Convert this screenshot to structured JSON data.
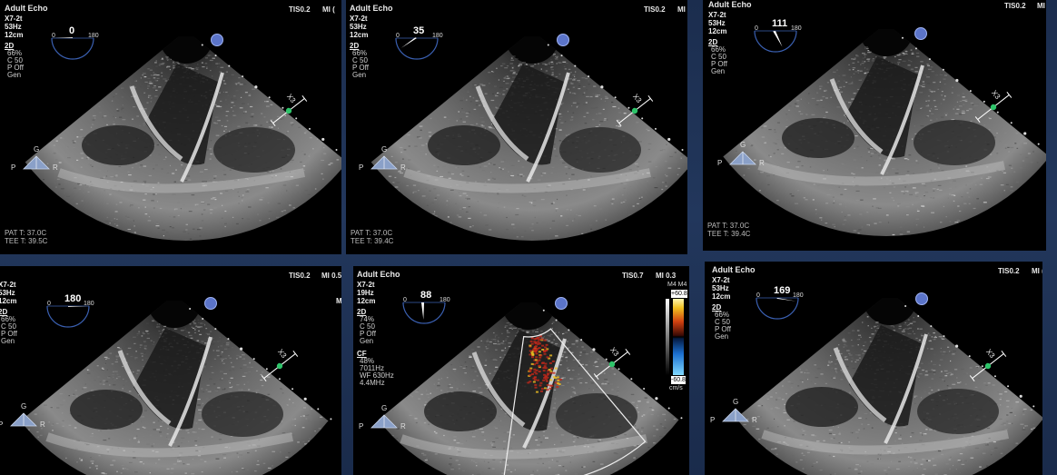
{
  "panels": [
    {
      "header": "Adult Echo",
      "tis": "TIS0.2",
      "mi": "MI (",
      "probe": "X7-2t",
      "freq": "53Hz",
      "depth": "12cm",
      "mode": "2D",
      "gain": "66%",
      "c": "C 50",
      "p": "P Off",
      "gen": "Gen",
      "angle": "0",
      "angle_lo": "0",
      "angle_hi": "180",
      "orient_g": "G",
      "orient_p": "P",
      "orient_r": "R",
      "pat_t": "PAT T: 37.0C",
      "tee_t": "TEE T: 39.5C"
    },
    {
      "header": "Adult Echo",
      "tis": "TIS0.2",
      "mi": "MI (",
      "probe": "X7-2t",
      "freq": "53Hz",
      "depth": "12cm",
      "mode": "2D",
      "gain": "66%",
      "c": "C 50",
      "p": "P Off",
      "gen": "Gen",
      "angle": "35",
      "angle_lo": "0",
      "angle_hi": "180",
      "orient_g": "G",
      "orient_p": "P",
      "orient_r": "R",
      "pat_t": "PAT T: 37.0C",
      "tee_t": "TEE T: 39.4C"
    },
    {
      "header": "Adult Echo",
      "tis": "TIS0.2",
      "mi": "MI",
      "probe": "X7-2t",
      "freq": "53Hz",
      "depth": "12cm",
      "mode": "2D",
      "gain": "66%",
      "c": "C 50",
      "p": "P Off",
      "gen": "Gen",
      "angle": "111",
      "angle_lo": "0",
      "angle_hi": "180",
      "orient_g": "G",
      "orient_p": "P",
      "orient_r": "R",
      "pat_t": "PAT T: 37.0C",
      "tee_t": "TEE T: 39.4C"
    },
    {
      "header": "",
      "tis": "TIS0.2",
      "mi": "MI 0.5",
      "probe": "X7-2t",
      "freq": "53Hz",
      "depth": "12cm",
      "mode": "2D",
      "gain": "66%",
      "c": "C 50",
      "p": "P Off",
      "gen": "Gen",
      "angle": "180",
      "angle_lo": "0",
      "angle_hi": "180",
      "orient_g": "G",
      "orient_p": "P",
      "orient_r": "R",
      "side": "M"
    },
    {
      "header": "Adult Echo",
      "tis": "TIS0.7",
      "mi": "MI 0.3",
      "probe": "X7-2t",
      "freq": "19Hz",
      "depth": "12cm",
      "mode": "2D",
      "gain": "74%",
      "c": "C 50",
      "p": "P Off",
      "gen": "Gen",
      "cf": "CF",
      "cf_gain": "48%",
      "cf_prf": "7011Hz",
      "cf_wf": "WF 630Hz",
      "cf_freq": "4.4MHz",
      "angle": "88",
      "angle_lo": "0",
      "angle_hi": "180",
      "orient_g": "G",
      "orient_p": "P",
      "orient_r": "R",
      "cb_top": "+60.8",
      "cb_bot": "-60.8",
      "cb_unit": "cm/s",
      "cb_label": "M4 M4"
    },
    {
      "header": "Adult Echo",
      "tis": "TIS0.2",
      "mi": "MI (",
      "probe": "X7-2t",
      "freq": "53Hz",
      "depth": "12cm",
      "mode": "2D",
      "gain": "66%",
      "c": "C 50",
      "p": "P Off",
      "gen": "Gen",
      "angle": "169",
      "angle_lo": "0",
      "angle_hi": "180",
      "orient_g": "G",
      "orient_p": "P",
      "orient_r": "R"
    }
  ],
  "colors": {
    "doppler_red": "#c0281a",
    "doppler_yellow": "#f0c020",
    "doppler_blue": "#1b6fd0",
    "probe_marker": "#5b74c9",
    "scale_green": "#2ec46a"
  }
}
